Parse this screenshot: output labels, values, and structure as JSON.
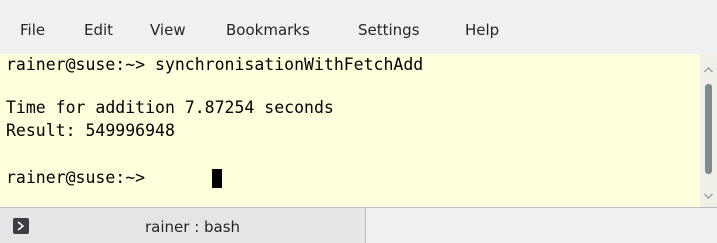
{
  "menu": {
    "items": [
      "File",
      "Edit",
      "View",
      "Bookmarks",
      "Settings",
      "Help"
    ]
  },
  "terminal": {
    "lines": [
      "rainer@suse:~> synchronisationWithFetchAdd",
      "",
      "Time for addition 7.87254 seconds",
      "Result: 549996948",
      "",
      "rainer@suse:~> "
    ]
  },
  "tabs": [
    {
      "label": "rainer : bash",
      "icon": "terminal-icon"
    }
  ],
  "colors": {
    "terminal_background": "#ffffdd",
    "terminal_text": "#000000",
    "menubar_background": "#eff0f1"
  }
}
